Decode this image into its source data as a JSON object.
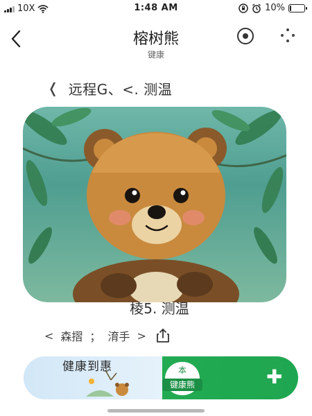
{
  "status_bar": {
    "carrier": "10X",
    "time": "1:48 AM",
    "battery_percent": "10%",
    "battery_level": 0.1,
    "icons": [
      "signal-icon",
      "wifi-icon",
      "lock-rotation-icon",
      "alarm-icon",
      "battery-icon"
    ]
  },
  "header": {
    "title": "榕树熊",
    "subtitle": "键康",
    "icons": [
      "back-chevron-icon",
      "target-icon",
      "more-dots-icon"
    ]
  },
  "breadcrumb": {
    "prefix_icon": "chevron-left-icon",
    "text": "远程G、<. 测温"
  },
  "hero": {
    "image": "bear-illustration",
    "colors": {
      "forest": "#4f9e91",
      "fur": "#c98a3e",
      "fur_dark": "#8a5a2b"
    }
  },
  "caption": "棱5. 测温",
  "actions": {
    "left_chevron": "<",
    "item_a": "森摺",
    "separator": "；",
    "item_b": "淯手",
    "right_chevron": ">",
    "share_icon": "share-icon"
  },
  "banner": {
    "title": "健康到惠",
    "badge_top": "本",
    "badge_label": "键康熊",
    "plus_icon": "plus-icon",
    "chevron_icon": "chevron-right-icon",
    "accent": "#22ab52"
  }
}
